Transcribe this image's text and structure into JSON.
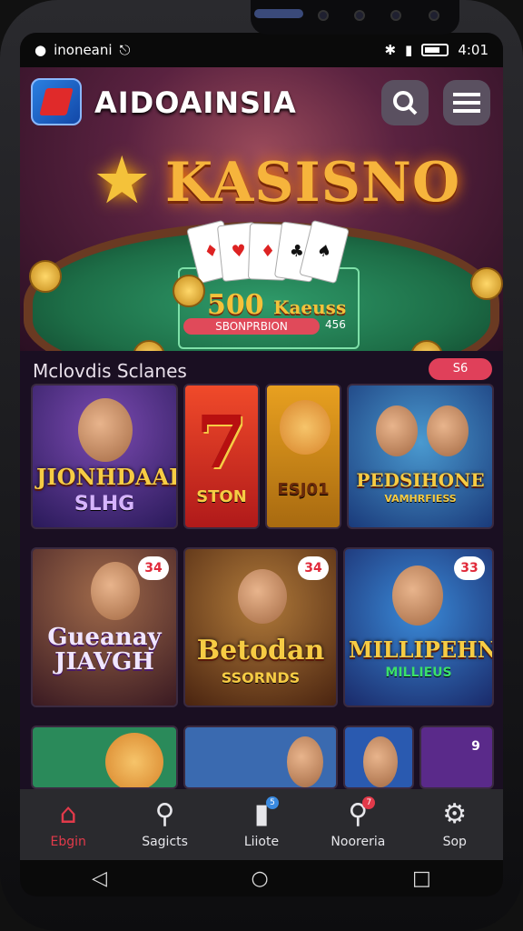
{
  "status_bar": {
    "left_text": "inoneani",
    "time": "4:01"
  },
  "header": {
    "brand": "AIDOAINSIA",
    "headline": "KASISNO",
    "search_icon": "search-icon",
    "menu_icon": "hamburger-menu-icon"
  },
  "hero": {
    "prize_amount": "500",
    "prize_suffix": "Kaeuss",
    "pill_label": "SBONPRBION",
    "pill_number": "456"
  },
  "section": {
    "title": "Mclovdis Sclanes",
    "badge": "S6"
  },
  "games": [
    {
      "title": "JIONHDAAR",
      "subtitle": "SLHG"
    },
    {
      "title": "7",
      "subtitle": "STON"
    },
    {
      "title": "",
      "subtitle": "ESJ01"
    },
    {
      "title": "PEDSIHONE",
      "subtitle": "VAMHRFIESS"
    },
    {
      "title": "Gueanay JIAVGH",
      "subtitle": "",
      "corner": "34"
    },
    {
      "title": "Betodan",
      "subtitle": "SSORNDS",
      "corner": "34"
    },
    {
      "title": "MILLIPEHN",
      "subtitle": "MILLIEUS",
      "corner": "33"
    }
  ],
  "bottom_row_corner": "9",
  "nav": [
    {
      "label": "Ebgin",
      "icon": "home-icon",
      "active": true
    },
    {
      "label": "Sagicts",
      "icon": "search-icon",
      "active": false
    },
    {
      "label": "Liiote",
      "icon": "notification-icon",
      "active": false,
      "dot": "5"
    },
    {
      "label": "Nooreria",
      "icon": "chat-icon",
      "active": false,
      "dot": "7"
    },
    {
      "label": "Sop",
      "icon": "gear-icon",
      "active": false
    }
  ],
  "colors": {
    "accent": "#e23a4a",
    "gold": "#f6b43c",
    "felt": "#1d6e47"
  }
}
